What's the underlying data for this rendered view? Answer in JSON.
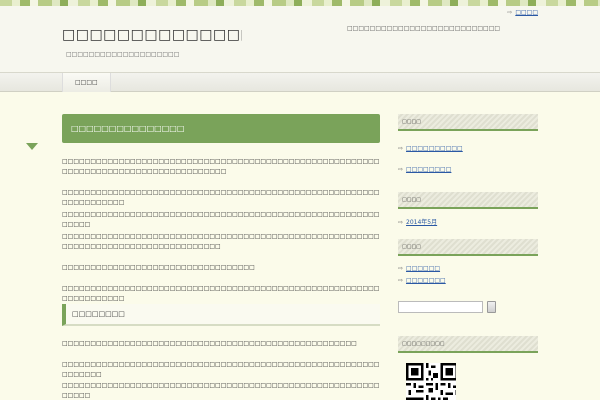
{
  "header": {
    "site_title": "□□□□□□□□□□□□□□□□□□□□",
    "site_description": "□□□□□□□□□□□□□□□□□□□□",
    "tagline": "□□□□□□□□□□□□□□□□□□□□□□□□□□□",
    "top_link": "□□□□"
  },
  "nav": {
    "items": [
      "□□□□"
    ]
  },
  "post": {
    "title": "□□□□□□□□□□□□□□□",
    "paragraphs": [
      "□□□□□□□□□□□□□□□□□□□□□□□□□□□□□□□□□□□□□□□□□□□□□□□□□□□□□□□□□□□□□□□□□□□□□□□□□□□□□□□□□□□□□",
      "□□□□□□□□□□□□□□□□□□□□□□□□□□□□□□□□□□□□□□□□□□□□□□□□□□□□□□□□□□□□□□□□□□□",
      "□□□□□□□□□□□□□□□□□□□□□□□□□□□□□□□□□□□□□□□□□□□□□□□□□□□□□□□□□□□□□",
      "□□□□□□□□□□□□□□□□□□□□□□□□□□□□□□□□□□□□□□□□□□□□□□□□□□□□□□□□□□□□□□□□□□□□□□□□□□□□□□□□□□□□",
      "□□□□□□□□□□□□□□□□□□□□□□□□□□□□□□□□□□",
      "□□□□□□□□□□□□□□□□□□□□□□□□□□□□□□□□□□□□□□□□□□□□□□□□□□□□□□□□□□□□□□□□□□□"
    ],
    "subheading": "□□□□□□□□",
    "paragraphs_after": [
      "□□□□□□□□□□□□□□□□□□□□□□□□□□□□□□□□□□□□□□□□□□□□□□□□□□□□",
      "□□□□□□□□□□□□□□□□□□□□□□□□□□□□□□□□□□□□□□□□□□□□□□□□□□□□□□□□□□□□□□□",
      "□□□□□□□□□□□□□□□□□□□□□□□□□□□□□□□□□□□□□□□□□□□□□□□□□□□□□□□□□□□□□"
    ]
  },
  "sidebar": {
    "widget1_title": "□□□□",
    "widget1_links": [
      "□□□□□□□□□□",
      "□□□□□□□□"
    ],
    "widget2_title": "□□□□",
    "widget2_link": "2014年5月",
    "widget3_title": "□□□□",
    "widget3_links": [
      "□□□□□□",
      "□□□□□□□"
    ],
    "widget4_title": "□□□□□□□□□"
  }
}
